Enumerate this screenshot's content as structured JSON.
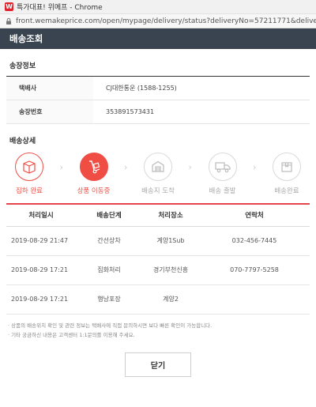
{
  "window": {
    "title": "특가대표! 위메프 - Chrome",
    "url": "front.wemakeprice.com/open/mypage/delivery/status?deliveryNo=57211771&deliveryT..."
  },
  "header": {
    "title": "배송조회"
  },
  "invoice": {
    "section_title": "송장정보",
    "rows": [
      {
        "label": "택배사",
        "value": "CJ대한통운 (1588-1255)"
      },
      {
        "label": "송장번호",
        "value": "353891573431"
      }
    ]
  },
  "details": {
    "section_title": "배송상세",
    "steps": [
      {
        "label": "집하 완료",
        "icon": "box-icon",
        "state": "done"
      },
      {
        "label": "상품 이동중",
        "icon": "hand-truck-icon",
        "state": "active"
      },
      {
        "label": "배송지 도착",
        "icon": "warehouse-icon",
        "state": "pending"
      },
      {
        "label": "배송 출발",
        "icon": "truck-icon",
        "state": "pending"
      },
      {
        "label": "배송완료",
        "icon": "package-icon",
        "state": "pending"
      }
    ],
    "columns": [
      "처리일시",
      "배송단계",
      "처리장소",
      "연락처"
    ],
    "rows": [
      {
        "time": "2019-08-29 21:47",
        "stage": "간선상차",
        "place": "계양1Sub",
        "contact": "032-456-7445"
      },
      {
        "time": "2019-08-29 17:21",
        "stage": "집화처리",
        "place": "경기부천신흥",
        "contact": "070-7797-5258"
      },
      {
        "time": "2019-08-29 17:21",
        "stage": "행낭포장",
        "place": "계양2",
        "contact": ""
      }
    ]
  },
  "notes": [
    "· 상품의 배송위치 확인 및 관련 정보는 택배사에 직접 문의하시면 보다 빠른 확인이 가능합니다.",
    "· 기타 궁금하신 내용은 고객센터 1:1문의를 이용해 주세요."
  ],
  "close_label": "닫기",
  "colors": {
    "accent": "#f04e45",
    "header_bg": "#3a4451"
  }
}
